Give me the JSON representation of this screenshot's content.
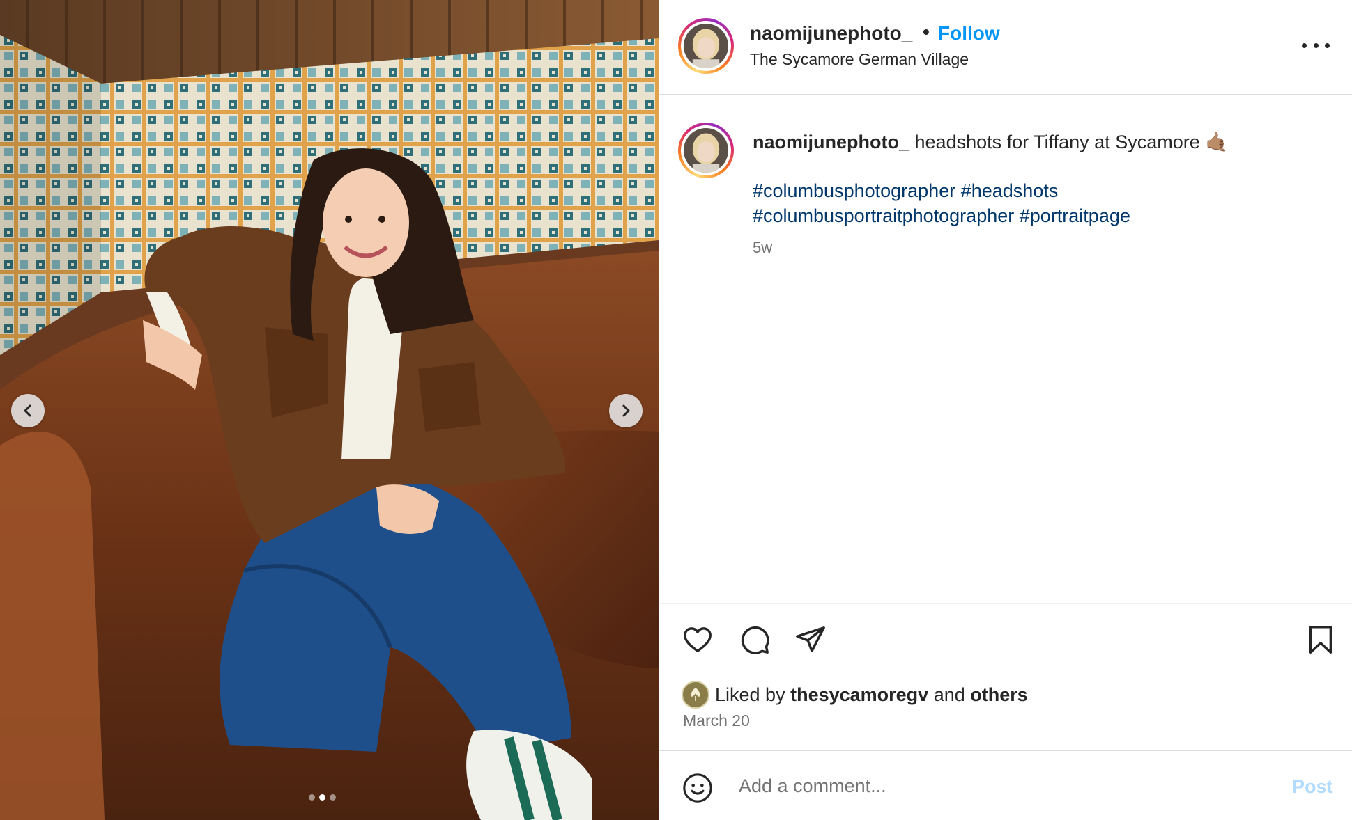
{
  "media": {
    "carousel": {
      "slide_count": 3,
      "active_index": 1
    }
  },
  "post": {
    "username": "naomijunephoto_",
    "separator": "•",
    "follow_label": "Follow",
    "location": "The Sycamore German Village",
    "caption_text": "headshots for Tiffany at Sycamore 🤙🏽",
    "hashtags_line1": [
      "#columbusphotographer",
      "#headshots"
    ],
    "hashtags_line2": [
      "#columbusportraitphotographer",
      "#portraitpage"
    ],
    "age": "5w"
  },
  "engagement": {
    "liked_by_prefix": "Liked by",
    "liked_by_user": "thesycamoregv",
    "liked_by_joiner": "and",
    "liked_by_others": "others",
    "date": "March 20"
  },
  "comment": {
    "placeholder": "Add a comment...",
    "post_label": "Post"
  },
  "colors": {
    "link_blue": "#0095f6",
    "hashtag": "#00376b",
    "muted": "#737373"
  },
  "icons": {
    "more": "more-icon",
    "like": "heart-icon",
    "comment": "comment-icon",
    "share": "share-icon",
    "save": "bookmark-icon",
    "emoji": "emoji-icon",
    "prev": "chevron-left-icon",
    "next": "chevron-right-icon"
  }
}
